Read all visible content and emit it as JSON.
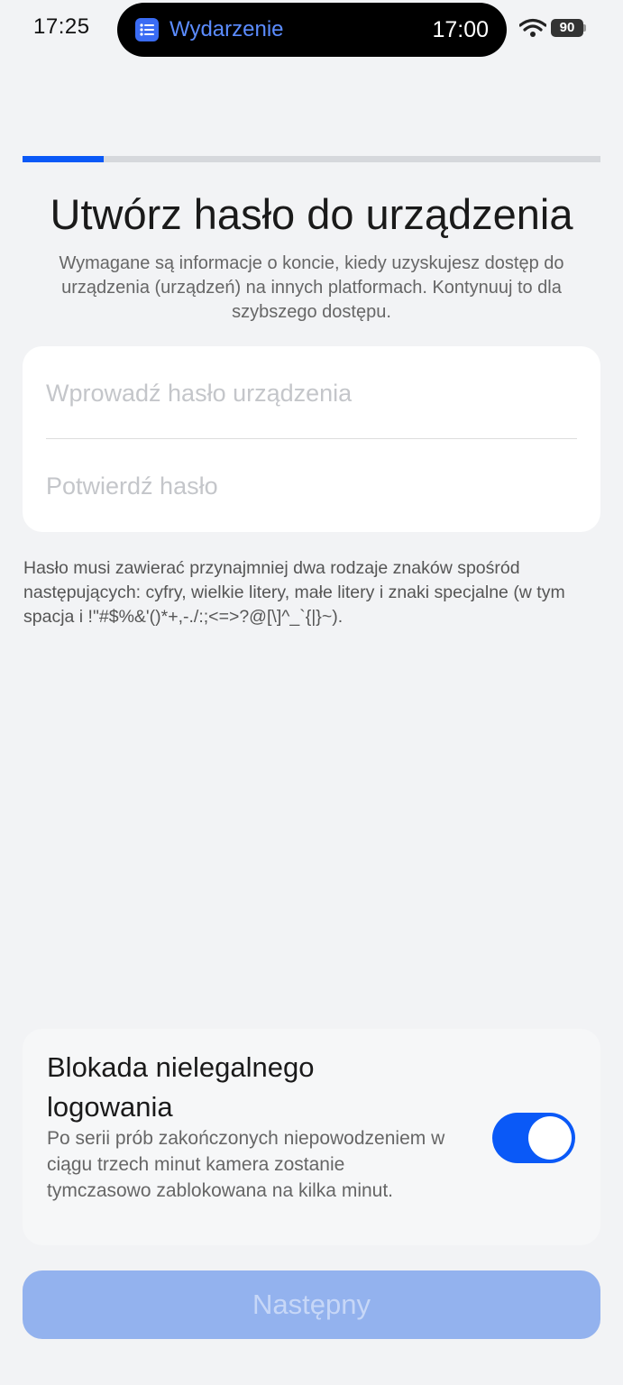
{
  "status_bar": {
    "time": "17:25",
    "island_title": "Wydarzenie",
    "island_time": "17:00",
    "battery": "90",
    "island_icon": "calendar-list-icon",
    "wifi_icon": "wifi-icon"
  },
  "progress": {
    "fraction": 0.14,
    "fill_color": "#0a59f7"
  },
  "page": {
    "title": "Utwórz hasło do urządzenia",
    "subtitle": "Wymagane są informacje o koncie, kiedy uzyskujesz dostęp do urządzenia (urządzeń) na innych platformach. Kontynuuj to dla szybszego dostępu."
  },
  "form": {
    "password_placeholder": "Wprowadź hasło urządzenia",
    "password_value": "",
    "confirm_placeholder": "Potwierdź hasło",
    "confirm_value": "",
    "hint": "Hasło musi zawierać przynajmniej dwa rodzaje znaków spośród następujących: cyfry, wielkie litery, małe litery i znaki specjalne (w tym spacja i !\"#$%&'()*+,-./:;<=>?@[\\]^_`{|}~)."
  },
  "illegal_login_lock": {
    "title": "Blokada nielegalnego logowania",
    "description": "Po serii prób zakończonych niepowodzeniem w ciągu trzech minut kamera zostanie tymczasowo zablokowana na kilka minut.",
    "enabled": true,
    "toggle_color": "#0a59f7"
  },
  "actions": {
    "next_label": "Następny",
    "next_disabled": true
  }
}
